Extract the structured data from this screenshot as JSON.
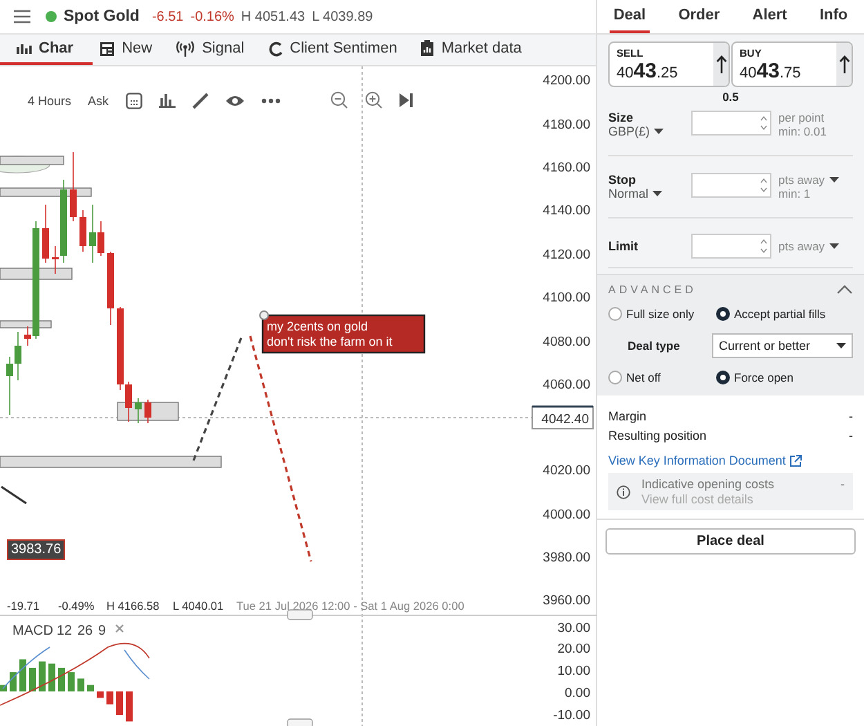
{
  "header": {
    "symbol": "Spot Gold",
    "change": "-6.51",
    "change_pct": "-0.16%",
    "high": "H 4051.43",
    "low": "L 4039.89",
    "market_open": true
  },
  "chart_tabs": [
    {
      "label": "Char",
      "selected": true
    },
    {
      "label": "New",
      "selected": false
    },
    {
      "label": "Signal",
      "selected": false
    },
    {
      "label": "Client Sentimen",
      "selected": false
    },
    {
      "label": "Market data",
      "selected": false
    }
  ],
  "chart": {
    "interval": "4 Hours",
    "price_type": "Ask",
    "y_ticks": [
      "4200.00",
      "4180.00",
      "4160.00",
      "4140.00",
      "4120.00",
      "4100.00",
      "4080.00",
      "4060.00",
      "4020.00",
      "4000.00",
      "3980.00",
      "3960.00"
    ],
    "current_price": "4042.40",
    "annotation": [
      "my 2cents on gold",
      "don't risk the farm on it"
    ],
    "price_label": "3983.76",
    "stats": {
      "change": "-19.71",
      "change_pct": "-0.49%",
      "high": "H 4166.58",
      "low": "L 4040.01",
      "range": "Tue 21 Jul 2026 12:00 - Sat 1 Aug 2026 0:00"
    }
  },
  "macd": {
    "label": "MACD",
    "params": [
      "12",
      "26",
      "9"
    ],
    "y_ticks": [
      "30.00",
      "20.00",
      "10.00",
      "0.00",
      "-10.00"
    ]
  },
  "deal_tabs": [
    {
      "label": "Deal",
      "selected": true
    },
    {
      "label": "Order",
      "selected": false
    },
    {
      "label": "Alert",
      "selected": false
    },
    {
      "label": "Info",
      "selected": false
    }
  ],
  "deal": {
    "sell": {
      "label": "SELL",
      "lead": "40",
      "big": "43",
      "tail": ".25"
    },
    "buy": {
      "label": "BUY",
      "lead": "40",
      "big": "43",
      "tail": ".75"
    },
    "spread": "0.5",
    "size": {
      "label": "Size",
      "unit": "GBP(£)",
      "hint": "per point",
      "min": "min: 0.01"
    },
    "stop": {
      "label": "Stop",
      "type": "Normal",
      "mode": "pts away",
      "min": "min: 1"
    },
    "limit": {
      "label": "Limit",
      "mode": "pts away"
    },
    "advanced": {
      "title": "ADVANCED",
      "expanded": true,
      "fill_options": [
        {
          "label": "Full size only",
          "selected": false
        },
        {
          "label": "Accept partial fills",
          "selected": true
        }
      ],
      "deal_type_label": "Deal type",
      "deal_type": "Current or better",
      "open_options": [
        {
          "label": "Net off",
          "selected": false
        },
        {
          "label": "Force open",
          "selected": true
        }
      ]
    },
    "summary": [
      {
        "label": "Margin",
        "value": "-"
      },
      {
        "label": "Resulting position",
        "value": "-"
      }
    ],
    "kid_link": "View Key Information Document",
    "costs": {
      "title": "Indicative opening costs",
      "link": "View full cost details",
      "value": "-"
    },
    "place_button": "Place deal"
  }
}
